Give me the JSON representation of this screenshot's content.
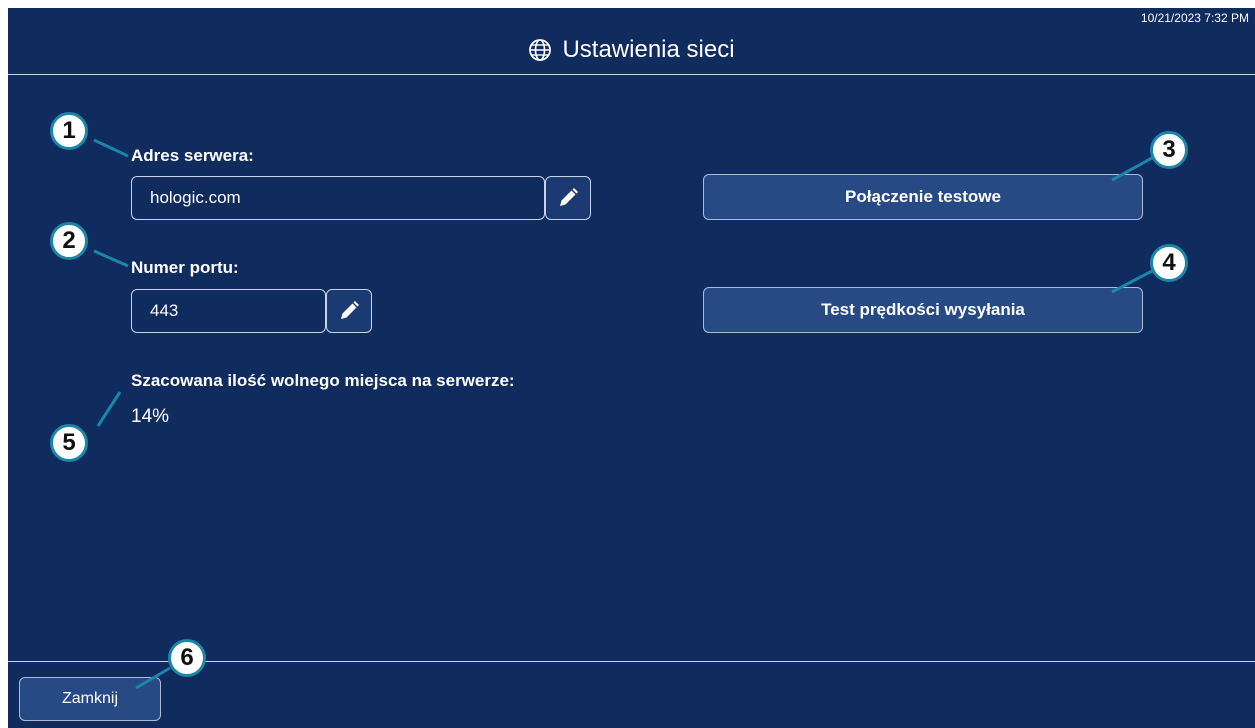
{
  "header": {
    "title": "Ustawienia sieci",
    "timestamp": "10/21/2023 7:32 PM"
  },
  "server": {
    "label": "Adres serwera:",
    "value": "hologic.com"
  },
  "port": {
    "label": "Numer portu:",
    "value": "443"
  },
  "buttons": {
    "test_connection": "Połączenie testowe",
    "upload_speed_test": "Test prędkości wysyłania",
    "close": "Zamknij"
  },
  "storage": {
    "label": "Szacowana ilość wolnego miejsca na serwerze:",
    "value": "14%"
  },
  "callouts": [
    "1",
    "2",
    "3",
    "4",
    "5",
    "6"
  ],
  "colors": {
    "background": "#102b5e",
    "button": "#274a84",
    "callout_border": "#1a86a8"
  },
  "icons": [
    "globe-icon",
    "pencil-icon"
  ]
}
